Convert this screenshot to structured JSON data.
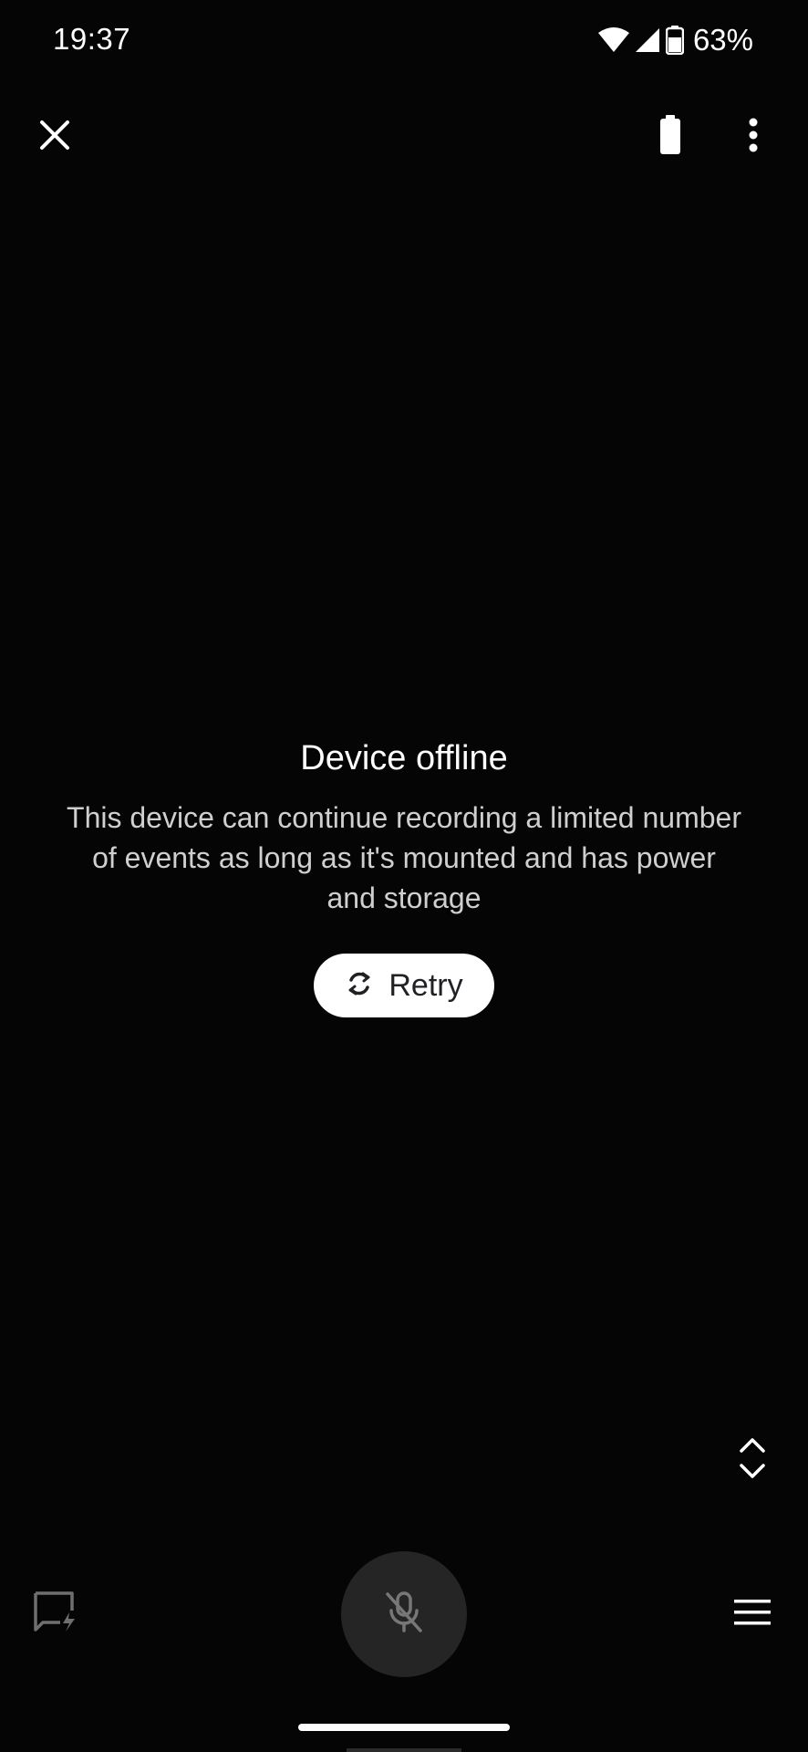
{
  "status_bar": {
    "time": "19:37",
    "battery_percent": "63%",
    "icons": [
      "wifi-icon",
      "cell-signal-icon",
      "battery-icon"
    ]
  },
  "top_bar": {
    "icons": [
      "close-icon",
      "battery-status-icon",
      "more-vert-icon"
    ]
  },
  "offline_state": {
    "title": "Device offline",
    "message": "This device can continue recording a limited number of events as long as it's mounted and has power and storage",
    "retry_label": "Retry"
  },
  "bottom_controls": {
    "icons": [
      "quick-response-icon",
      "mic-off-icon",
      "hamburger-menu-icon",
      "expand-collapse-icon"
    ]
  },
  "colors": {
    "background": "#050505",
    "text_primary": "#ffffff",
    "text_secondary": "#cfcfcf",
    "button_bg": "#ffffff",
    "button_text": "#202124",
    "mic_button_bg": "#252525"
  }
}
